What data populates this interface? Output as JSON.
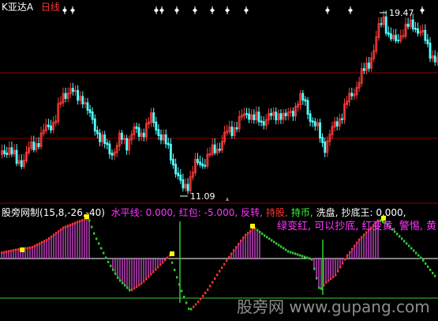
{
  "header": {
    "symbol": "K亚达A",
    "period": "日线",
    "colors": {
      "symbol": "#ffffff",
      "period": "#ff3333"
    }
  },
  "main_chart": {
    "high_label": "19.47",
    "low_label": "11.09",
    "marker_icon": "diamond-marker-icon",
    "colors": {
      "up": "#ff3c3c",
      "down": "#54ffff",
      "grid": "#8a0000"
    }
  },
  "indicator": {
    "name": "股旁网制",
    "params": "(15,8,-26,-40)",
    "items": [
      {
        "label": "水平线: 0.000,",
        "color": "#ff33ff"
      },
      {
        "label": "红包: -5.000,",
        "color": "#ff33ff"
      },
      {
        "label": "反转,",
        "color": "#ff33ff"
      },
      {
        "label": "持股,",
        "color": "#ff3333"
      },
      {
        "label": "持币,",
        "color": "#33ff33"
      },
      {
        "label": "洗盘,",
        "color": "#ffffff"
      },
      {
        "label": "抄底王: 0.000,",
        "color": "#ffffff"
      }
    ],
    "alert": "绿变红, 可以抄底, 红变黄, 警惕, 黄",
    "colors": {
      "magenta": "#cc44cc",
      "red": "#ff3333",
      "green": "#33cc33",
      "yellow": "#ffff00",
      "level": "#ffffff"
    }
  },
  "watermark": "股旁网 www.gupang.com"
}
